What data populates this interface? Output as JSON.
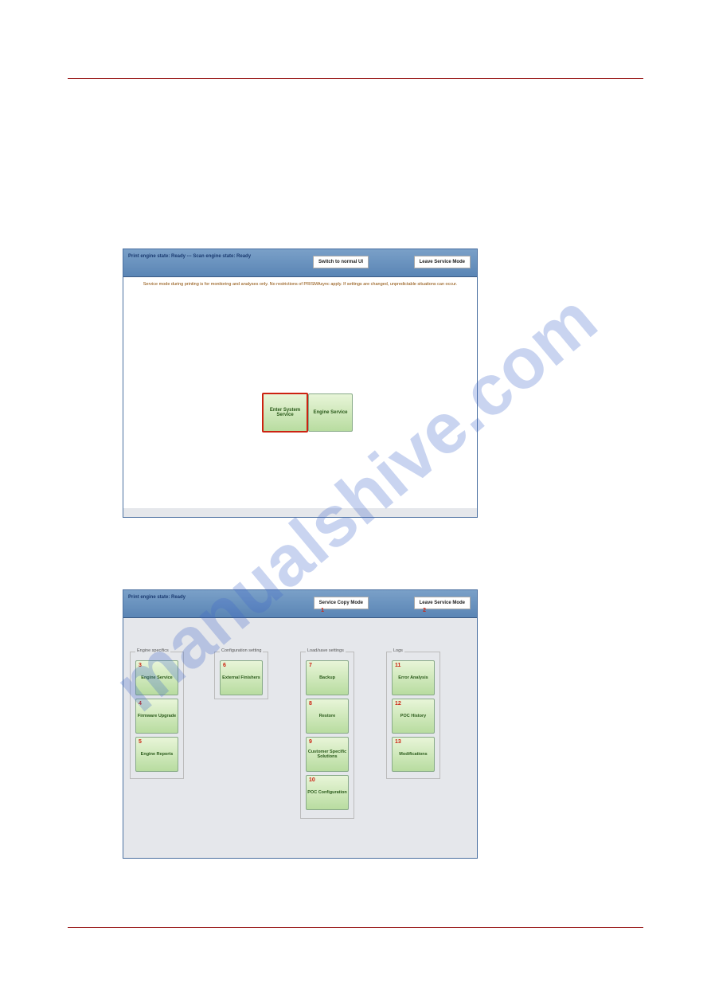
{
  "watermark": "manualshive.com",
  "shot1": {
    "status": "Print engine state: Ready --- Scan engine state: Ready",
    "btn1": "Switch to normal UI",
    "btn2": "Leave Service Mode",
    "warn": "Service mode during printing is for monitoring and analyses only. No restrictions of PRISMAsync apply. If settings are changed, unpredictable situations can occur.",
    "mid1": "Enter System Service",
    "mid2": "Engine Service"
  },
  "shot2": {
    "status": "Print engine state: Ready",
    "btn1": "Service Copy Mode",
    "n1": "1",
    "btn2": "Leave Service Mode",
    "n2": "2",
    "groups": {
      "g1": {
        "label": "Engine specifics",
        "items": [
          {
            "n": "3",
            "t": "Engine Service"
          },
          {
            "n": "4",
            "t": "Firmware Upgrade"
          },
          {
            "n": "5",
            "t": "Engine Reports"
          }
        ]
      },
      "g2": {
        "label": "Configuration setting",
        "items": [
          {
            "n": "6",
            "t": "External Finishers"
          }
        ]
      },
      "g3": {
        "label": "Load/save settings",
        "items": [
          {
            "n": "7",
            "t": "Backup"
          },
          {
            "n": "8",
            "t": "Restore"
          },
          {
            "n": "9",
            "t": "Customer Specific Solutions"
          },
          {
            "n": "10",
            "t": "POC Configuration"
          }
        ]
      },
      "g4": {
        "label": "Logs",
        "items": [
          {
            "n": "11",
            "t": "Error Analysis"
          },
          {
            "n": "12",
            "t": "POC History"
          },
          {
            "n": "13",
            "t": "Modifications"
          }
        ]
      }
    }
  }
}
